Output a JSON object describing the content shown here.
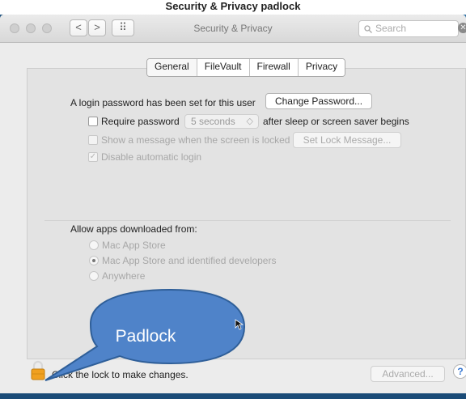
{
  "header_caption": "Security & Privacy padlock",
  "window": {
    "title": "Security & Privacy",
    "search_placeholder": "Search",
    "nav_back": "<",
    "nav_forward": ">",
    "grid": "⠿"
  },
  "tabs": [
    "General",
    "FileVault",
    "Firewall",
    "Privacy"
  ],
  "general": {
    "login_text": "A login password has been set for this user",
    "change_password": "Change Password...",
    "require_password_label": "Require password",
    "require_password_value": "5 seconds",
    "after_sleep": "after sleep or screen saver begins",
    "show_message": "Show a message when the screen is locked",
    "set_lock_message": "Set Lock Message...",
    "disable_auto_login": "Disable automatic login"
  },
  "apps": {
    "heading": "Allow apps downloaded from:",
    "options": [
      "Mac App Store",
      "Mac App Store and identified developers",
      "Anywhere"
    ],
    "selected_index": 1
  },
  "footer": {
    "lock_text": "Click the lock to make changes.",
    "advanced": "Advanced...",
    "help": "?"
  },
  "annotation": {
    "callout_text": "Padlock"
  },
  "colors": {
    "callout_fill": "#4f83c9",
    "callout_border": "#2f5f99",
    "padlock": "#f0a020",
    "desktop": "#2d6da0"
  },
  "icons": [
    "search-icon",
    "clear-search-icon",
    "padlock-icon",
    "help-icon",
    "cursor-icon"
  ]
}
